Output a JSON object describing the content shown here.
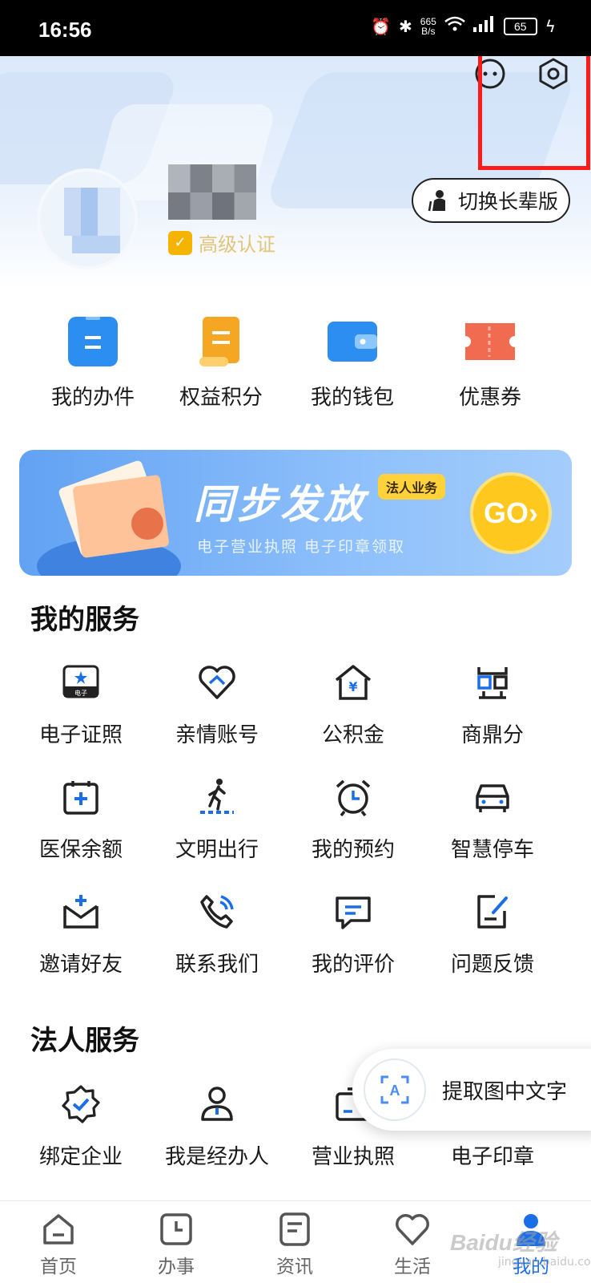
{
  "status_bar": {
    "time": "16:56",
    "net_speed_value": "665",
    "net_speed_unit": "B/s",
    "battery": "65"
  },
  "header": {
    "elder_mode_label": "切换长辈版",
    "auth_label": "高级认证"
  },
  "quick_actions": [
    {
      "label": "我的办件",
      "icon": "document-icon",
      "color": "#2b8ef0"
    },
    {
      "label": "权益积分",
      "icon": "scroll-icon",
      "color": "#f5a623"
    },
    {
      "label": "我的钱包",
      "icon": "wallet-icon",
      "color": "#2b8ef0"
    },
    {
      "label": "优惠券",
      "icon": "coupon-icon",
      "color": "#f06b4f"
    }
  ],
  "banner": {
    "title": "同步发放",
    "tag": "法人业务",
    "subtitle": "电子营业执照 电子印章领取",
    "go_label": "GO"
  },
  "my_services": {
    "title": "我的服务",
    "items": [
      {
        "label": "电子证照",
        "icon": "e-license-icon",
        "icon_text": "电子"
      },
      {
        "label": "亲情账号",
        "icon": "family-heart-icon"
      },
      {
        "label": "公积金",
        "icon": "housing-fund-icon"
      },
      {
        "label": "商鼎分",
        "icon": "shangding-icon"
      },
      {
        "label": "医保余额",
        "icon": "medical-insurance-icon"
      },
      {
        "label": "文明出行",
        "icon": "pedestrian-icon"
      },
      {
        "label": "我的预约",
        "icon": "alarm-clock-icon"
      },
      {
        "label": "智慧停车",
        "icon": "car-icon"
      },
      {
        "label": "邀请好友",
        "icon": "invite-mail-icon"
      },
      {
        "label": "联系我们",
        "icon": "phone-icon"
      },
      {
        "label": "我的评价",
        "icon": "comment-icon"
      },
      {
        "label": "问题反馈",
        "icon": "feedback-icon"
      }
    ]
  },
  "legal_services": {
    "title": "法人服务",
    "items": [
      {
        "label": "绑定企业",
        "icon": "verified-badge-icon"
      },
      {
        "label": "我是经办人",
        "icon": "agent-person-icon"
      },
      {
        "label": "营业执照",
        "icon": "business-license-icon"
      },
      {
        "label": "电子印章",
        "icon": "e-seal-icon"
      }
    ]
  },
  "ocr_button": {
    "label": "提取图中文字"
  },
  "bottom_nav": [
    {
      "label": "首页",
      "icon": "home-icon"
    },
    {
      "label": "办事",
      "icon": "clock-icon"
    },
    {
      "label": "资讯",
      "icon": "news-icon"
    },
    {
      "label": "生活",
      "icon": "heart-icon"
    },
    {
      "label": "我的",
      "icon": "profile-icon",
      "active": true
    }
  ],
  "watermark": {
    "text": "Baidu经验",
    "sub": "jingyan.baidu.com"
  },
  "colors": {
    "accent": "#1a6fe8",
    "highlight": "#ff1a1a"
  }
}
